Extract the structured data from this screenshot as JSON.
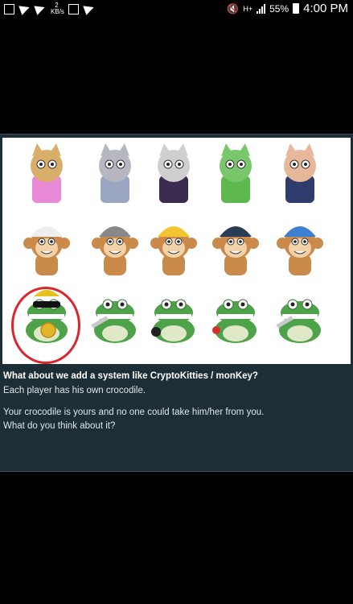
{
  "status_bar": {
    "data_rate_value": "2",
    "data_rate_unit": "KB/s",
    "network": "H+",
    "battery": "55%",
    "time": "4:00 PM"
  },
  "post": {
    "title": "What about we add a system like CryptoKitties / monKey?",
    "lines": [
      "Each player has his own crocodile.",
      "Your crocodile is yours and no one could take him/her from you.",
      "What do you think about it?"
    ]
  },
  "image": {
    "rows": [
      {
        "kind": "cat",
        "items": [
          "striped-cat",
          "robot-cat",
          "vampire-cat",
          "green-monster-cat",
          "sailor-cat"
        ]
      },
      {
        "kind": "monkey",
        "items": [
          "cap-monkey",
          "beanie-monkey",
          "crown-monkey",
          "cigar-monkey",
          "blue-cap-monkey"
        ]
      },
      {
        "kind": "crocodile",
        "items": [
          "sunglasses-coin-crocodile",
          "knife-crocodile",
          "bomb-crocodile",
          "rose-crocodile",
          "knife-crocodile-2"
        ]
      }
    ],
    "highlight": "sunglasses-coin-crocodile",
    "colors": {
      "highlight": "#d9262c",
      "croc": "#4ea24a",
      "monkey": "#c98a4b"
    }
  }
}
